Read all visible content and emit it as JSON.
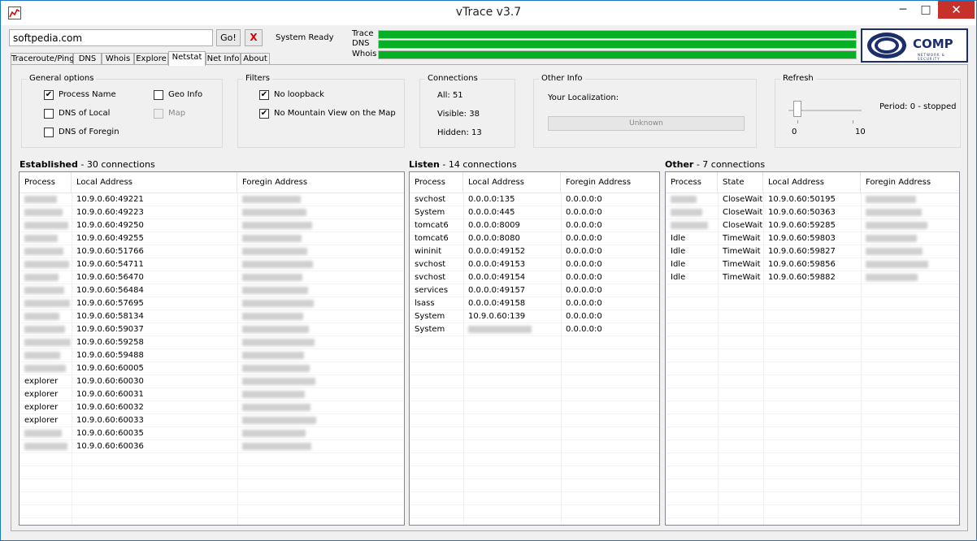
{
  "window": {
    "title": "vTrace v3.7",
    "minimize_glyph": "─",
    "maximize_glyph": "□",
    "close_glyph": "✕"
  },
  "toolbar": {
    "url_value": "softpedia.com",
    "go_label": "Go!",
    "stop_label": "X",
    "status_text": "System Ready"
  },
  "progress": [
    {
      "label": "Trace",
      "percent": 100
    },
    {
      "label": "DNS",
      "percent": 100
    },
    {
      "label": "Whois",
      "percent": 100
    }
  ],
  "logo": {
    "text": "COMP",
    "subtext": "NETWORK & SECURITY"
  },
  "tabs": [
    "Traceroute/Ping",
    "DNS",
    "Whois",
    "Explore",
    "Netstat",
    "Net Info",
    "About"
  ],
  "active_tab": "Netstat",
  "general_options": {
    "title": "General options",
    "items": [
      {
        "label": "Process Name",
        "checked": true,
        "disabled": false
      },
      {
        "label": "DNS of Local",
        "checked": false,
        "disabled": false
      },
      {
        "label": "DNS of Foregin",
        "checked": false,
        "disabled": false
      },
      {
        "label": "Geo Info",
        "checked": false,
        "disabled": false
      },
      {
        "label": "Map",
        "checked": false,
        "disabled": true
      }
    ]
  },
  "filters": {
    "title": "Filters",
    "items": [
      {
        "label": "No loopback",
        "checked": true
      },
      {
        "label": "No Mountain View on the Map",
        "checked": true
      }
    ]
  },
  "connections": {
    "title": "Connections",
    "all": "All: 51",
    "visible": "Visible: 38",
    "hidden": "Hidden: 13"
  },
  "other_info": {
    "title": "Other Info",
    "localization_label": "Your Localization:",
    "localization_button": "Unknown"
  },
  "refresh": {
    "title": "Refresh",
    "min_label": "0",
    "max_label": "10",
    "period_text": "Period: 0 - stopped",
    "slider_value": 0
  },
  "established": {
    "title": "Established",
    "count_text": "-  30 connections",
    "columns": [
      "Process",
      "Local Address",
      "Foregin Address"
    ],
    "rows": [
      {
        "process": "",
        "local": "10.9.0.60:49221"
      },
      {
        "process": "",
        "local": "10.9.0.60:49223"
      },
      {
        "process": "",
        "local": "10.9.0.60:49250"
      },
      {
        "process": "",
        "local": "10.9.0.60:49255"
      },
      {
        "process": "",
        "local": "10.9.0.60:51766"
      },
      {
        "process": "",
        "local": "10.9.0.60:54711"
      },
      {
        "process": "",
        "local": "10.9.0.60:56470"
      },
      {
        "process": "",
        "local": "10.9.0.60:56484"
      },
      {
        "process": "",
        "local": "10.9.0.60:57695"
      },
      {
        "process": "",
        "local": "10.9.0.60:58134"
      },
      {
        "process": "",
        "local": "10.9.0.60:59037"
      },
      {
        "process": "",
        "local": "10.9.0.60:59258"
      },
      {
        "process": "",
        "local": "10.9.0.60:59488"
      },
      {
        "process": "",
        "local": "10.9.0.60:60005"
      },
      {
        "process": "explorer",
        "local": "10.9.0.60:60030"
      },
      {
        "process": "explorer",
        "local": "10.9.0.60:60031"
      },
      {
        "process": "explorer",
        "local": "10.9.0.60:60032"
      },
      {
        "process": "explorer",
        "local": "10.9.0.60:60033"
      },
      {
        "process": "",
        "local": "10.9.0.60:60035"
      },
      {
        "process": "",
        "local": "10.9.0.60:60036"
      }
    ]
  },
  "listen": {
    "title": "Listen",
    "count_text": "-  14 connections",
    "columns": [
      "Process",
      "Local Address",
      "Foregin Address"
    ],
    "rows": [
      {
        "process": "svchost",
        "local": "0.0.0.0:135",
        "foreign": "0.0.0.0:0"
      },
      {
        "process": "System",
        "local": "0.0.0.0:445",
        "foreign": "0.0.0.0:0"
      },
      {
        "process": "tomcat6",
        "local": "0.0.0.0:8009",
        "foreign": "0.0.0.0:0"
      },
      {
        "process": "tomcat6",
        "local": "0.0.0.0:8080",
        "foreign": "0.0.0.0:0"
      },
      {
        "process": "wininit",
        "local": "0.0.0.0:49152",
        "foreign": "0.0.0.0:0"
      },
      {
        "process": "svchost",
        "local": "0.0.0.0:49153",
        "foreign": "0.0.0.0:0"
      },
      {
        "process": "svchost",
        "local": "0.0.0.0:49154",
        "foreign": "0.0.0.0:0"
      },
      {
        "process": "services",
        "local": "0.0.0.0:49157",
        "foreign": "0.0.0.0:0"
      },
      {
        "process": "lsass",
        "local": "0.0.0.0:49158",
        "foreign": "0.0.0.0:0"
      },
      {
        "process": "System",
        "local": "10.9.0.60:139",
        "foreign": "0.0.0.0:0"
      },
      {
        "process": "System",
        "local": "",
        "foreign": "0.0.0.0:0"
      }
    ]
  },
  "other": {
    "title": "Other",
    "count_text": "-  7 connections",
    "columns": [
      "Process",
      "State",
      "Local Address",
      "Foregin Address"
    ],
    "rows": [
      {
        "process": "",
        "state": "CloseWait",
        "local": "10.9.0.60:50195"
      },
      {
        "process": "",
        "state": "CloseWait",
        "local": "10.9.0.60:50363"
      },
      {
        "process": "",
        "state": "CloseWait",
        "local": "10.9.0.60:59285"
      },
      {
        "process": "Idle",
        "state": "TimeWait",
        "local": "10.9.0.60:59803"
      },
      {
        "process": "Idle",
        "state": "TimeWait",
        "local": "10.9.0.60:59827"
      },
      {
        "process": "Idle",
        "state": "TimeWait",
        "local": "10.9.0.60:59856"
      },
      {
        "process": "Idle",
        "state": "TimeWait",
        "local": "10.9.0.60:59882"
      }
    ]
  }
}
